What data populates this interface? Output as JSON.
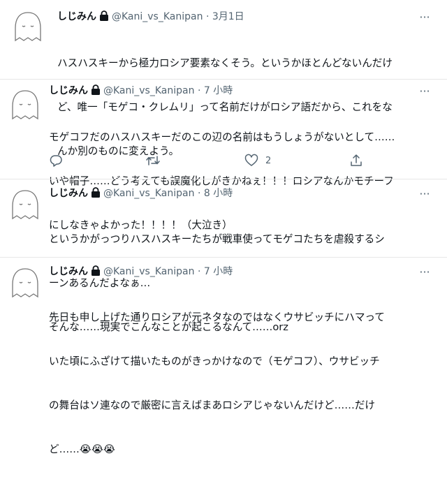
{
  "tweets": [
    {
      "name": "しじみん",
      "handle": "@Kani_vs_Kanipan",
      "sep": "·",
      "time": "3月1日",
      "more": "···",
      "lines": [
        "ハスハスキーから極力ロシア要素なくそう。というかほとんどないんだけ",
        "ど、唯一「モゲコ・クレムリ」って名前だけがロシア語だから、これをな",
        "んか別のものに変えよう。"
      ]
    },
    {
      "name": "しじみん",
      "handle": "@Kani_vs_Kanipan",
      "sep": "·",
      "time": "7 小時",
      "more": "···",
      "lines": [
        "モゲコフだのハスハスキーだのこの辺の名前はもうしょうがないとして……",
        "いや帽子……どう考えても誤魔化しがきかねぇ！！！ロシアなんかモチーフ",
        "にしなきゃよかった！！！！（大泣き）"
      ],
      "actions": {
        "reply_count": "",
        "retweet_count": "",
        "like_count": "2"
      }
    },
    {
      "name": "しじみん",
      "handle": "@Kani_vs_Kanipan",
      "sep": "·",
      "time": "8 小時",
      "more": "···",
      "lines": [
        "というかがっつりハスハスキーたちが戦車使ってモゲコたちを虐殺するシ",
        "ーンあるんだよなぁ…",
        "そんな……現実でこんなことが起こるなんて……orz"
      ]
    },
    {
      "name": "しじみん",
      "handle": "@Kani_vs_Kanipan",
      "sep": "·",
      "time": "7 小時",
      "more": "···",
      "lines": [
        "先日も申し上げた通りロシアが元ネタなのではなくウサビッチにハマって",
        "いた頃にふざけて描いたものがきっかけなので（モゲコフ）、ウサビッチ",
        "の舞台はソ連なので厳密に言えばまあロシアじゃないんだけど……だけ",
        "ど……😭😭😭"
      ]
    }
  ]
}
